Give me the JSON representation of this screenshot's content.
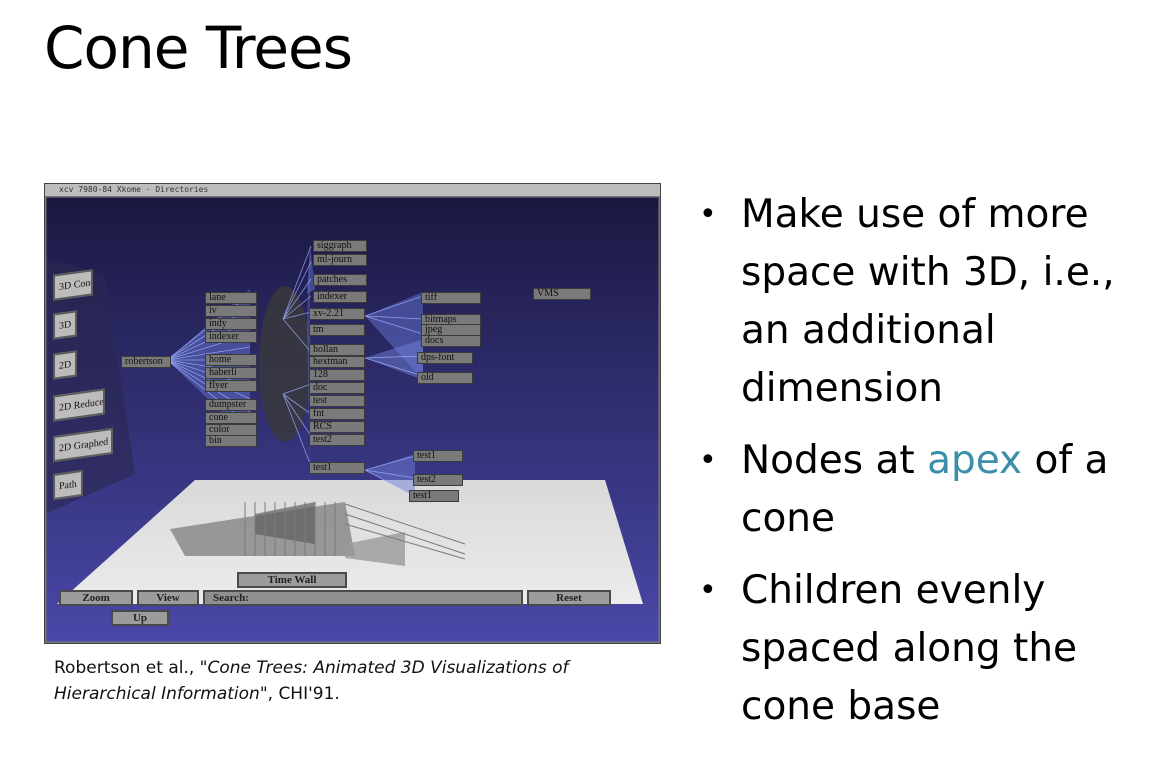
{
  "title": "Cone Trees",
  "figure": {
    "window_title": "xcv 7980-84 Xkome · Directories",
    "root_node": "robertson",
    "level1_nodes": [
      "lane",
      "iv",
      "indy",
      "indexer",
      "home",
      "haberli",
      "flyer",
      "dumpster",
      "cone",
      "color",
      "bin"
    ],
    "level2_nodes": [
      "siggraph",
      "ml-journ",
      "patches",
      "indexer",
      "xv-2.21",
      "tm",
      "hollan",
      "hextman",
      "128",
      "doc",
      "test",
      "fnt",
      "RCS",
      "test2",
      "test1"
    ],
    "level3_nodes": [
      "tiff",
      "bitmaps",
      "jpeg",
      "docs",
      "dps-font",
      "old"
    ],
    "level4_nodes": [
      "test1",
      "test2",
      "test1"
    ],
    "vms_node": "VMS",
    "side_buttons": [
      "3D Cone",
      "3D",
      "2D",
      "2D Reduced",
      "2D Graphed",
      "Path"
    ],
    "controls": {
      "time_wall": "Time Wall",
      "zoom": "Zoom",
      "view": "View",
      "search": "Search:",
      "reset": "Reset",
      "up": "Up"
    }
  },
  "caption": {
    "prefix": "Robertson et al., \"",
    "title_italic": "Cone Trees: Animated 3D Visualizations of Hierarchical Information",
    "suffix": "\", CHI'91."
  },
  "bullets": [
    {
      "text": "Make use of more space with 3D, i.e., an additional dimension"
    },
    {
      "before": "Nodes at ",
      "accent": "apex",
      "after": " of a cone"
    },
    {
      "text": "Children evenly spaced along the cone base"
    }
  ],
  "colors": {
    "accent": "#3b8fa8",
    "figure_background": "#1e1c46"
  }
}
